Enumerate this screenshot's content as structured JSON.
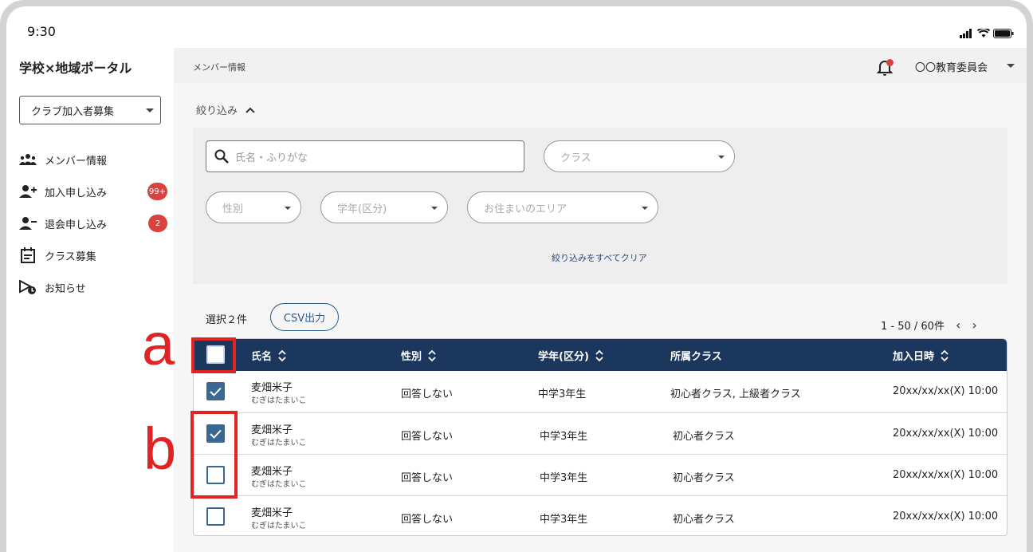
{
  "status_bar": {
    "time": "9:30"
  },
  "app_title": "学校×地域ポータル",
  "club_select": {
    "value": "クラブ加入者募集"
  },
  "nav": {
    "items": [
      {
        "label": "メンバー情報",
        "icon": "members-icon",
        "badge": ""
      },
      {
        "label": "加入申し込み",
        "icon": "person-add-icon",
        "badge": "99+"
      },
      {
        "label": "退会申し込み",
        "icon": "person-remove-icon",
        "badge": "2"
      },
      {
        "label": "クラス募集",
        "icon": "calendar-icon",
        "badge": ""
      },
      {
        "label": "お知らせ",
        "icon": "announcement-icon",
        "badge": ""
      }
    ]
  },
  "header": {
    "breadcrumb": "メンバー情報",
    "org_name": "〇〇教育委員会"
  },
  "filters": {
    "toggle_label": "絞り込み",
    "search_placeholder": "氏名・ふりがな",
    "class_placeholder": "クラス",
    "gender_placeholder": "性別",
    "grade_placeholder": "学年(区分)",
    "area_placeholder": "お住まいのエリア",
    "clear_all": "絞り込みをすべてクリア"
  },
  "toolbar": {
    "selected_count": "選択２件",
    "csv_button": "CSV出力",
    "pagination": "1 - 50 / 60件"
  },
  "table": {
    "columns": [
      "氏名",
      "性別",
      "学年(区分)",
      "所属クラス",
      "加入日時"
    ],
    "rows": [
      {
        "name": "麦畑米子",
        "kana": "むぎはたまいこ",
        "gender": "回答しない",
        "grade": "中学3年生",
        "class": "初心者クラス, 上級者クラス",
        "date": "20xx/xx/xx(X) 10:00",
        "checked": true
      },
      {
        "name": "麦畑米子",
        "kana": "むぎはたまいこ",
        "gender": "回答しない",
        "grade": "中学3年生",
        "class": "初心者クラス",
        "date": "20xx/xx/xx(X) 10:00",
        "checked": true
      },
      {
        "name": "麦畑米子",
        "kana": "むぎはたまいこ",
        "gender": "回答しない",
        "grade": "中学3年生",
        "class": "初心者クラス",
        "date": "20xx/xx/xx(X) 10:00",
        "checked": false
      },
      {
        "name": "麦畑米子",
        "kana": "むぎはたまいこ",
        "gender": "回答しない",
        "grade": "中学3年生",
        "class": "初心者クラス",
        "date": "20xx/xx/xx(X) 10:00",
        "checked": false
      }
    ]
  },
  "annotations": {
    "a": "a",
    "b": "b"
  },
  "colors": {
    "header_bg": "#1c375e",
    "accent": "#3a6893",
    "badge": "#d9433f",
    "annotation": "#e02424"
  }
}
